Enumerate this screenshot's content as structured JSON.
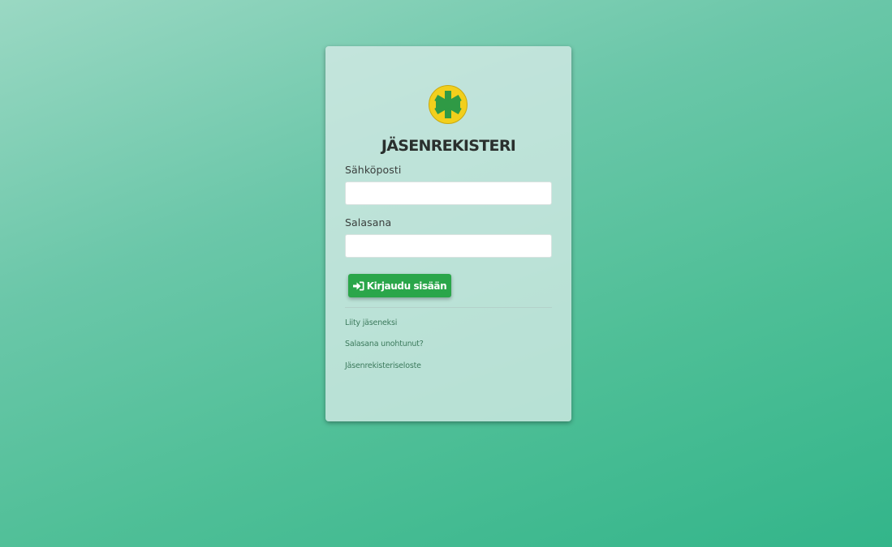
{
  "brand": {
    "title": "JÄSENREKISTERI",
    "logo_icon": "green-asterisk-logo-icon",
    "colors": {
      "logo_circle": "#f2cf1c",
      "logo_mark": "#2f9a45",
      "button": "#2aa64a",
      "link": "#3c7a5c"
    }
  },
  "form": {
    "email_label": "Sähköposti",
    "email_value": "",
    "password_label": "Salasana",
    "password_value": "",
    "submit_label": "Kirjaudu sisään",
    "submit_icon": "sign-in-icon"
  },
  "links": [
    {
      "label": "Liity jäseneksi"
    },
    {
      "label": "Salasana unohtunut?"
    },
    {
      "label": "Jäsenrekisteriseloste"
    }
  ]
}
